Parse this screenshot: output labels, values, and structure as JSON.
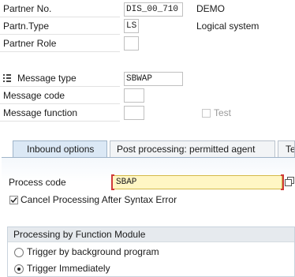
{
  "header_fields": {
    "partner_no": {
      "label": "Partner No.",
      "value": "DIS_00_710",
      "desc": "DEMO"
    },
    "partn_type": {
      "label": "Partn.Type",
      "value": "LS",
      "desc": "Logical system"
    },
    "partner_role": {
      "label": "Partner Role",
      "value": ""
    }
  },
  "message_fields": {
    "message_type": {
      "label": "Message type",
      "value": "SBWAP"
    },
    "message_code": {
      "label": "Message code",
      "value": ""
    },
    "message_function": {
      "label": "Message function",
      "value": ""
    },
    "test_label": "Test"
  },
  "tabs": [
    {
      "label": "Inbound options"
    },
    {
      "label": "Post processing: permitted agent"
    },
    {
      "label": "Te"
    }
  ],
  "inbound": {
    "process_code_label": "Process code",
    "process_code_value": "SBAP",
    "cancel_processing_label": "Cancel Processing After Syntax Error",
    "cancel_processing_checked": true
  },
  "function_module_group": {
    "title": "Processing by Function Module",
    "options": [
      {
        "label": "Trigger by background program",
        "selected": false
      },
      {
        "label": "Trigger Immediately",
        "selected": true
      }
    ]
  }
}
